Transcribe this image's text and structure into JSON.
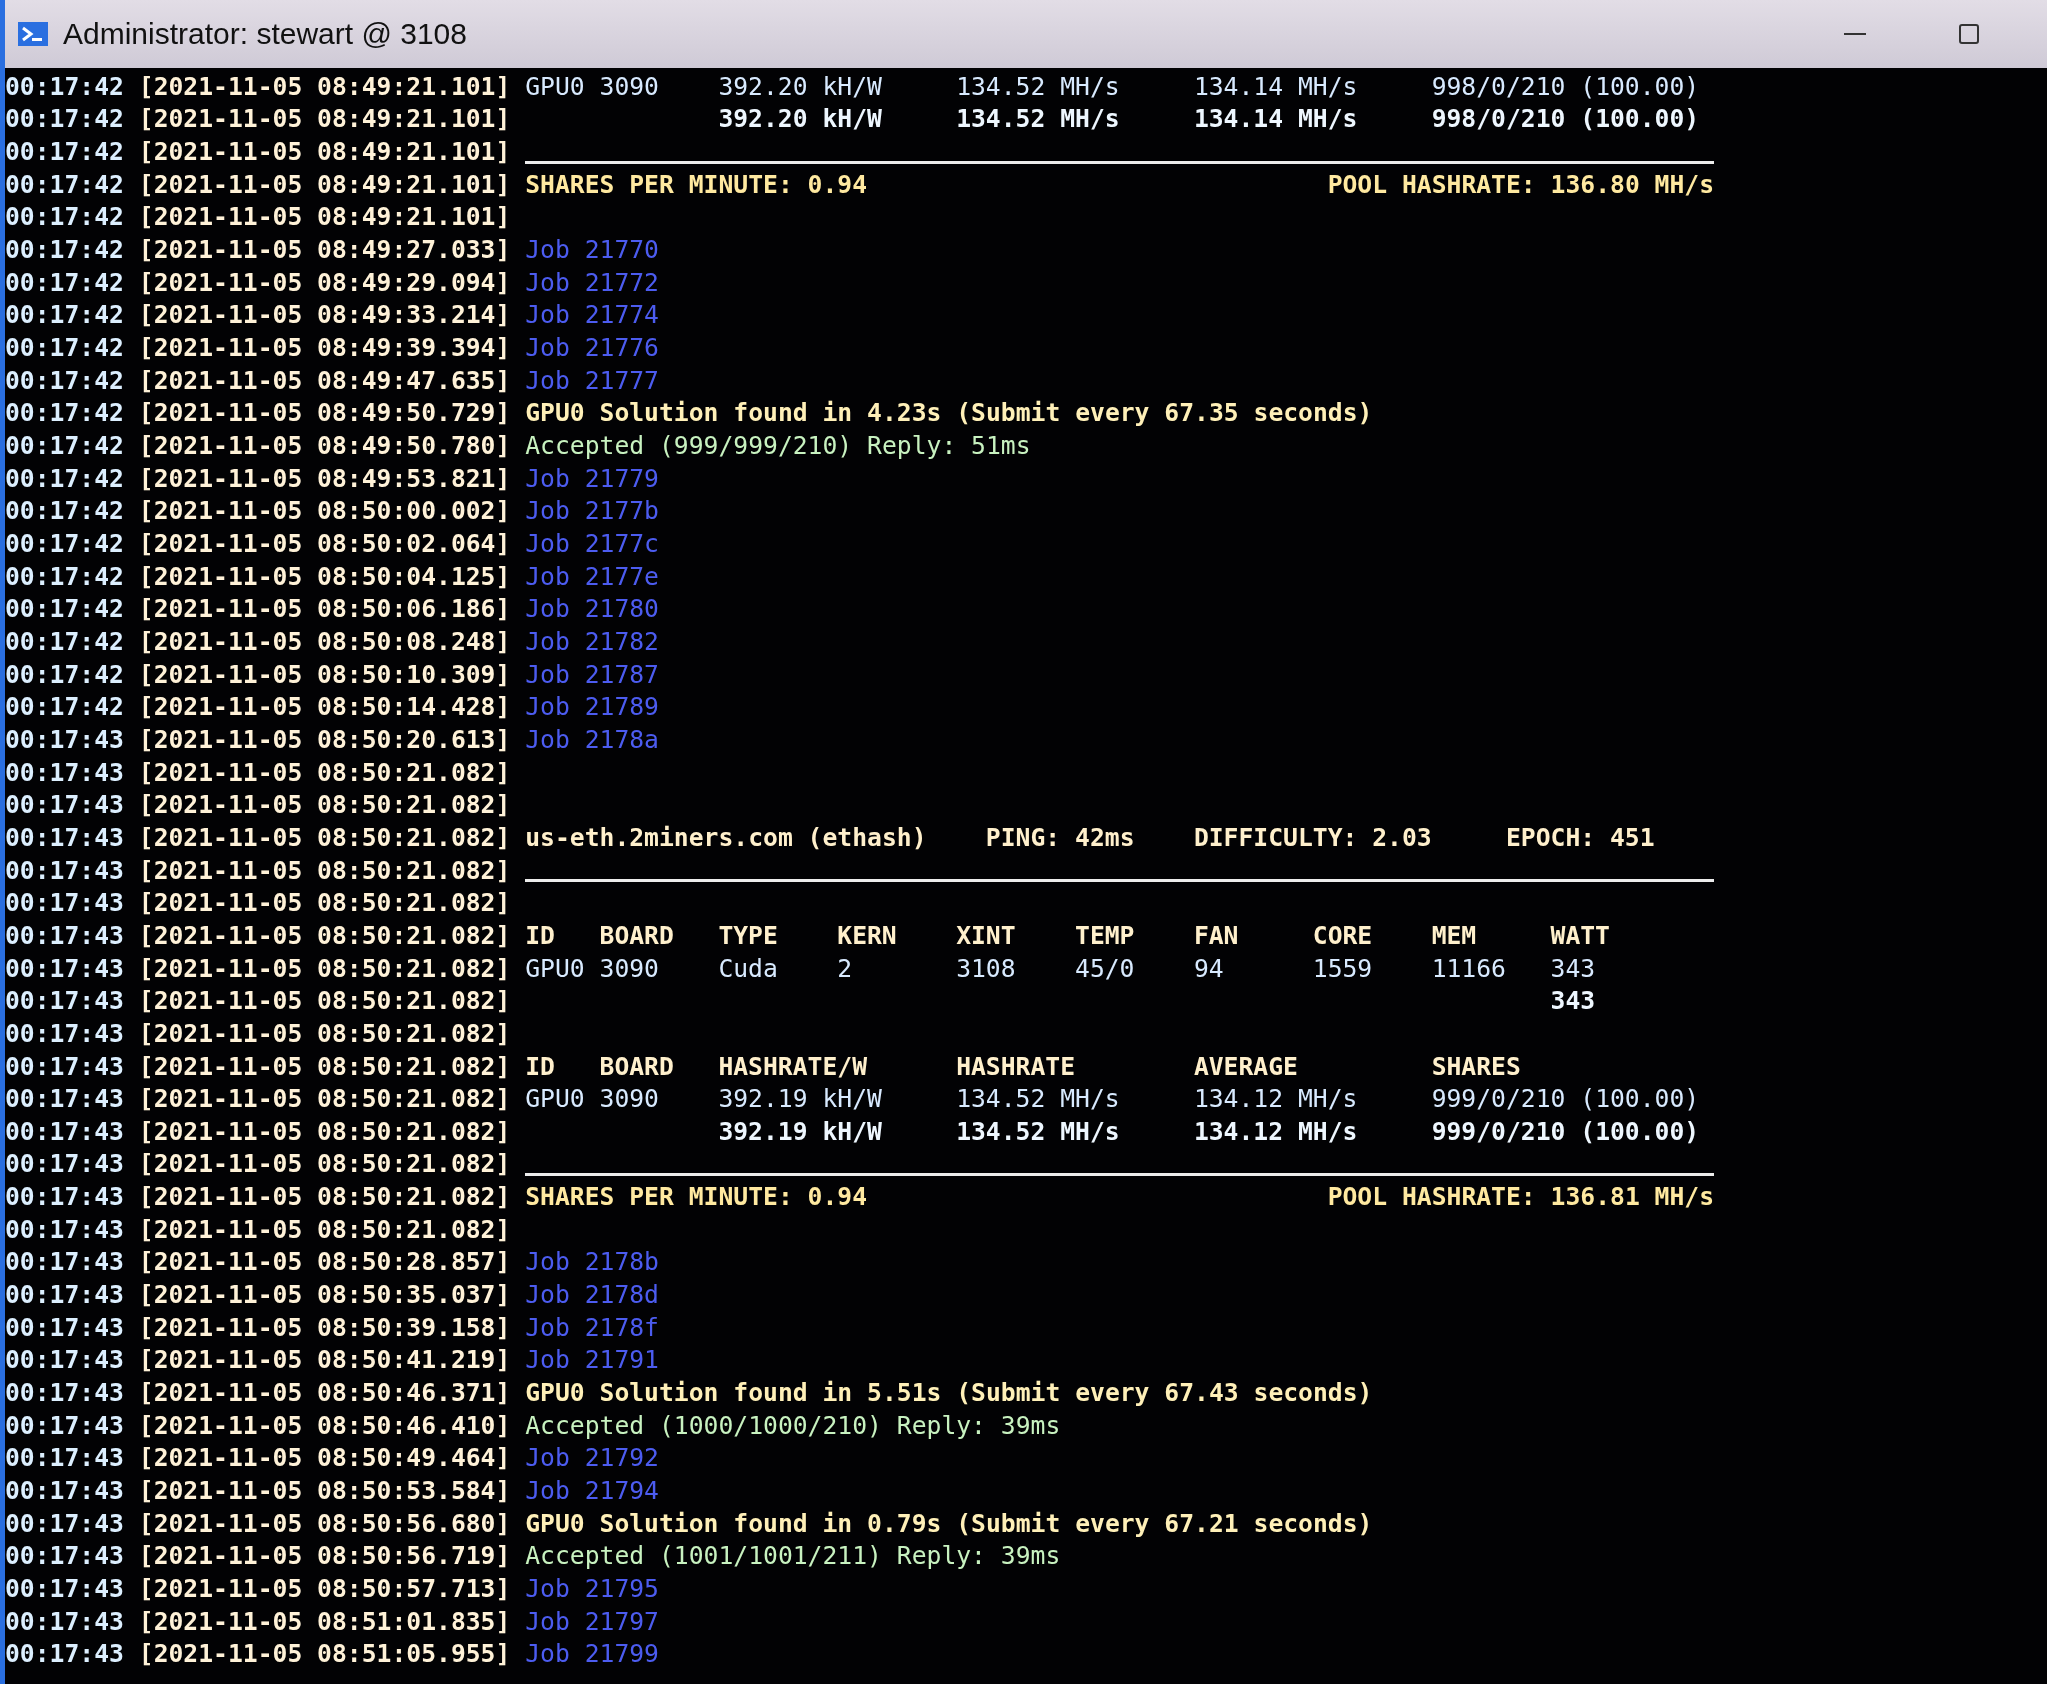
{
  "window": {
    "title": "Administrator: stewart @ 3108"
  },
  "lines": [
    {
      "time": "00:17:42",
      "stamp": "[2021-11-05 08:49:21.101]",
      "kind": "hash-row",
      "cells": [
        "GPU0",
        "3090",
        "392.20 kH/W",
        "134.52 MH/s",
        "134.14 MH/s",
        "998/0/210 (100.00)"
      ]
    },
    {
      "time": "00:17:42",
      "stamp": "[2021-11-05 08:49:21.101]",
      "kind": "hash-total",
      "cells": [
        "392.20 kH/W",
        "134.52 MH/s",
        "134.14 MH/s",
        "998/0/210 (100.00)"
      ]
    },
    {
      "time": "00:17:42",
      "stamp": "[2021-11-05 08:49:21.101]",
      "kind": "rule"
    },
    {
      "time": "00:17:42",
      "stamp": "[2021-11-05 08:49:21.101]",
      "kind": "summary",
      "cells": [
        "SHARES PER MINUTE: 0.94",
        "POOL HASHRATE: 136.80 MH/s"
      ]
    },
    {
      "time": "00:17:42",
      "stamp": "[2021-11-05 08:49:21.101]",
      "kind": "blank"
    },
    {
      "time": "00:17:42",
      "stamp": "[2021-11-05 08:49:27.033]",
      "kind": "job",
      "text": "Job 21770"
    },
    {
      "time": "00:17:42",
      "stamp": "[2021-11-05 08:49:29.094]",
      "kind": "job",
      "text": "Job 21772"
    },
    {
      "time": "00:17:42",
      "stamp": "[2021-11-05 08:49:33.214]",
      "kind": "job",
      "text": "Job 21774"
    },
    {
      "time": "00:17:42",
      "stamp": "[2021-11-05 08:49:39.394]",
      "kind": "job",
      "text": "Job 21776"
    },
    {
      "time": "00:17:42",
      "stamp": "[2021-11-05 08:49:47.635]",
      "kind": "job",
      "text": "Job 21777"
    },
    {
      "time": "00:17:42",
      "stamp": "[2021-11-05 08:49:50.729]",
      "kind": "solution",
      "text": "GPU0 Solution found in 4.23s (Submit every 67.35 seconds)"
    },
    {
      "time": "00:17:42",
      "stamp": "[2021-11-05 08:49:50.780]",
      "kind": "accepted",
      "text": "Accepted (999/999/210) Reply: 51ms"
    },
    {
      "time": "00:17:42",
      "stamp": "[2021-11-05 08:49:53.821]",
      "kind": "job",
      "text": "Job 21779"
    },
    {
      "time": "00:17:42",
      "stamp": "[2021-11-05 08:50:00.002]",
      "kind": "job",
      "text": "Job 2177b"
    },
    {
      "time": "00:17:42",
      "stamp": "[2021-11-05 08:50:02.064]",
      "kind": "job",
      "text": "Job 2177c"
    },
    {
      "time": "00:17:42",
      "stamp": "[2021-11-05 08:50:04.125]",
      "kind": "job",
      "text": "Job 2177e"
    },
    {
      "time": "00:17:42",
      "stamp": "[2021-11-05 08:50:06.186]",
      "kind": "job",
      "text": "Job 21780"
    },
    {
      "time": "00:17:42",
      "stamp": "[2021-11-05 08:50:08.248]",
      "kind": "job",
      "text": "Job 21782"
    },
    {
      "time": "00:17:42",
      "stamp": "[2021-11-05 08:50:10.309]",
      "kind": "job",
      "text": "Job 21787"
    },
    {
      "time": "00:17:42",
      "stamp": "[2021-11-05 08:50:14.428]",
      "kind": "job",
      "text": "Job 21789"
    },
    {
      "time": "00:17:43",
      "stamp": "[2021-11-05 08:50:20.613]",
      "kind": "job",
      "text": "Job 2178a"
    },
    {
      "time": "00:17:43",
      "stamp": "[2021-11-05 08:50:21.082]",
      "kind": "blank"
    },
    {
      "time": "00:17:43",
      "stamp": "[2021-11-05 08:50:21.082]",
      "kind": "blank"
    },
    {
      "time": "00:17:43",
      "stamp": "[2021-11-05 08:50:21.082]",
      "kind": "pool-info",
      "cells": [
        "us-eth.2miners.com (ethash)",
        "PING: 42ms",
        "DIFFICULTY: 2.03",
        "EPOCH: 451"
      ]
    },
    {
      "time": "00:17:43",
      "stamp": "[2021-11-05 08:50:21.082]",
      "kind": "rule"
    },
    {
      "time": "00:17:43",
      "stamp": "[2021-11-05 08:50:21.082]",
      "kind": "blank"
    },
    {
      "time": "00:17:43",
      "stamp": "[2021-11-05 08:50:21.082]",
      "kind": "device-head",
      "cells": [
        "ID",
        "BOARD",
        "TYPE",
        "KERN",
        "XINT",
        "TEMP",
        "FAN",
        "CORE",
        "MEM",
        "WATT"
      ]
    },
    {
      "time": "00:17:43",
      "stamp": "[2021-11-05 08:50:21.082]",
      "kind": "device-row",
      "cells": [
        "GPU0",
        "3090",
        "Cuda",
        "2",
        "3108",
        "45/0",
        "94",
        "1559",
        "11166",
        "343"
      ]
    },
    {
      "time": "00:17:43",
      "stamp": "[2021-11-05 08:50:21.082]",
      "kind": "watt-total",
      "cells": [
        "343"
      ]
    },
    {
      "time": "00:17:43",
      "stamp": "[2021-11-05 08:50:21.082]",
      "kind": "blank"
    },
    {
      "time": "00:17:43",
      "stamp": "[2021-11-05 08:50:21.082]",
      "kind": "hash-head",
      "cells": [
        "ID",
        "BOARD",
        "HASHRATE/W",
        "HASHRATE",
        "AVERAGE",
        "SHARES"
      ]
    },
    {
      "time": "00:17:43",
      "stamp": "[2021-11-05 08:50:21.082]",
      "kind": "hash-row",
      "cells": [
        "GPU0",
        "3090",
        "392.19 kH/W",
        "134.52 MH/s",
        "134.12 MH/s",
        "999/0/210 (100.00)"
      ]
    },
    {
      "time": "00:17:43",
      "stamp": "[2021-11-05 08:50:21.082]",
      "kind": "hash-total",
      "cells": [
        "392.19 kH/W",
        "134.52 MH/s",
        "134.12 MH/s",
        "999/0/210 (100.00)"
      ]
    },
    {
      "time": "00:17:43",
      "stamp": "[2021-11-05 08:50:21.082]",
      "kind": "rule"
    },
    {
      "time": "00:17:43",
      "stamp": "[2021-11-05 08:50:21.082]",
      "kind": "summary",
      "cells": [
        "SHARES PER MINUTE: 0.94",
        "POOL HASHRATE: 136.81 MH/s"
      ]
    },
    {
      "time": "00:17:43",
      "stamp": "[2021-11-05 08:50:21.082]",
      "kind": "blank"
    },
    {
      "time": "00:17:43",
      "stamp": "[2021-11-05 08:50:28.857]",
      "kind": "job",
      "text": "Job 2178b"
    },
    {
      "time": "00:17:43",
      "stamp": "[2021-11-05 08:50:35.037]",
      "kind": "job",
      "text": "Job 2178d"
    },
    {
      "time": "00:17:43",
      "stamp": "[2021-11-05 08:50:39.158]",
      "kind": "job",
      "text": "Job 2178f"
    },
    {
      "time": "00:17:43",
      "stamp": "[2021-11-05 08:50:41.219]",
      "kind": "job",
      "text": "Job 21791"
    },
    {
      "time": "00:17:43",
      "stamp": "[2021-11-05 08:50:46.371]",
      "kind": "solution",
      "text": "GPU0 Solution found in 5.51s (Submit every 67.43 seconds)"
    },
    {
      "time": "00:17:43",
      "stamp": "[2021-11-05 08:50:46.410]",
      "kind": "accepted",
      "text": "Accepted (1000/1000/210) Reply: 39ms"
    },
    {
      "time": "00:17:43",
      "stamp": "[2021-11-05 08:50:49.464]",
      "kind": "job",
      "text": "Job 21792"
    },
    {
      "time": "00:17:43",
      "stamp": "[2021-11-05 08:50:53.584]",
      "kind": "job",
      "text": "Job 21794"
    },
    {
      "time": "00:17:43",
      "stamp": "[2021-11-05 08:50:56.680]",
      "kind": "solution",
      "text": "GPU0 Solution found in 0.79s (Submit every 67.21 seconds)"
    },
    {
      "time": "00:17:43",
      "stamp": "[2021-11-05 08:50:56.719]",
      "kind": "accepted",
      "text": "Accepted (1001/1001/211) Reply: 39ms"
    },
    {
      "time": "00:17:43",
      "stamp": "[2021-11-05 08:50:57.713]",
      "kind": "job",
      "text": "Job 21795"
    },
    {
      "time": "00:17:43",
      "stamp": "[2021-11-05 08:51:01.835]",
      "kind": "job",
      "text": "Job 21797"
    },
    {
      "time": "00:17:43",
      "stamp": "[2021-11-05 08:51:05.955]",
      "kind": "job",
      "text": "Job 21799"
    }
  ]
}
